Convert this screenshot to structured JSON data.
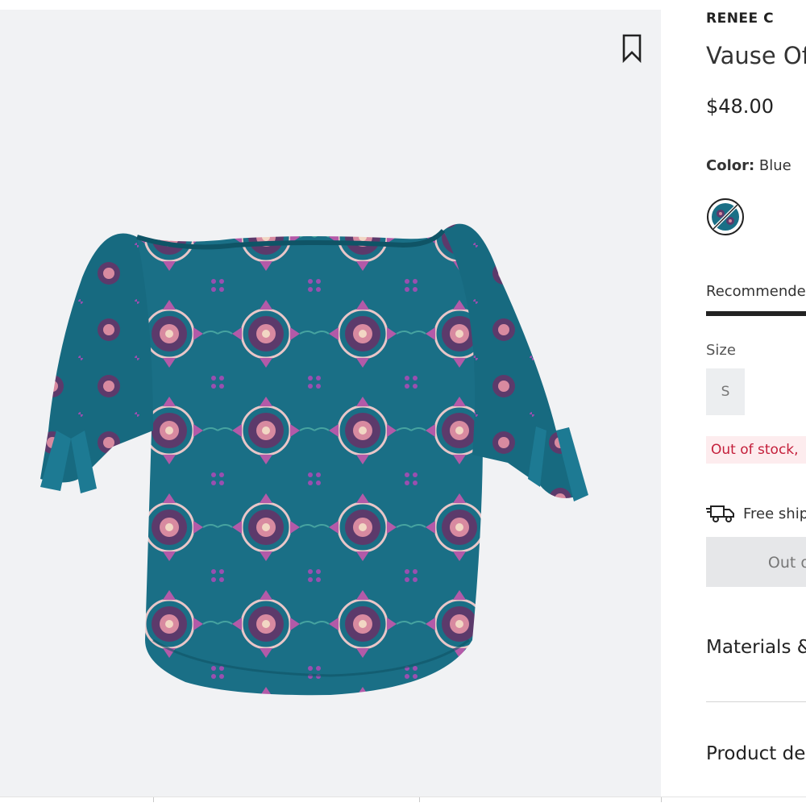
{
  "product": {
    "brand": "RENEE C",
    "title": "Vause Off",
    "price": "$48.00",
    "color_label": "Color:",
    "color_value": "Blue",
    "fit_tab_label": "Recommended",
    "size_label": "Size",
    "size_option": "S",
    "stock_message": "Out of stock,",
    "shipping_text": "Free shipping",
    "add_button_label": "Out of stock",
    "materials_heading": "Materials &",
    "details_heading": "Product details"
  },
  "icons": {
    "bookmark": "bookmark-icon",
    "truck": "truck-icon",
    "swatch": "blue-paisley-swatch"
  },
  "colors": {
    "image_background": "#f1f2f4",
    "garment_teal": "#1a6f86",
    "stock_alert_text": "#c41e3a",
    "stock_alert_bg": "#fdecee"
  }
}
